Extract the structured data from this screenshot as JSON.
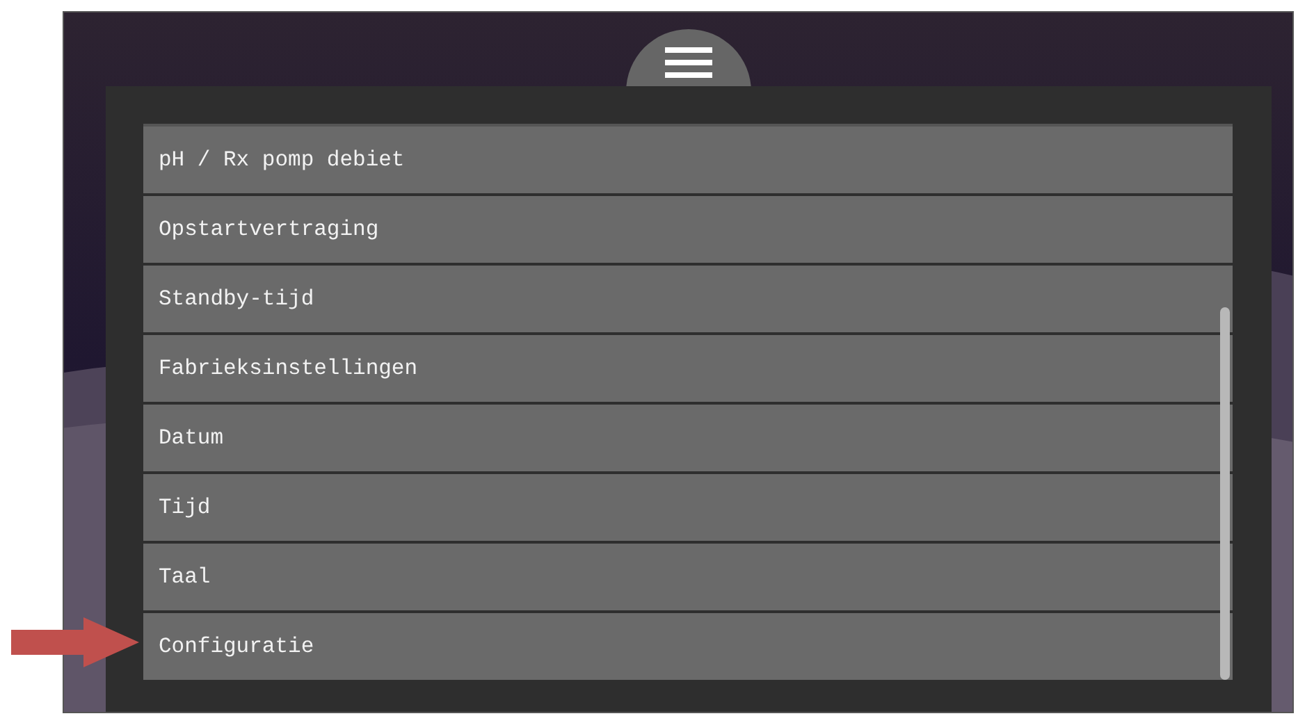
{
  "menu_items": [
    {
      "label": "pH / Rx pomp debiet"
    },
    {
      "label": "Opstartvertraging"
    },
    {
      "label": "Standby-tijd"
    },
    {
      "label": "Fabrieksinstellingen"
    },
    {
      "label": "Datum"
    },
    {
      "label": "Tijd"
    },
    {
      "label": "Taal"
    },
    {
      "label": "Configuratie"
    }
  ]
}
